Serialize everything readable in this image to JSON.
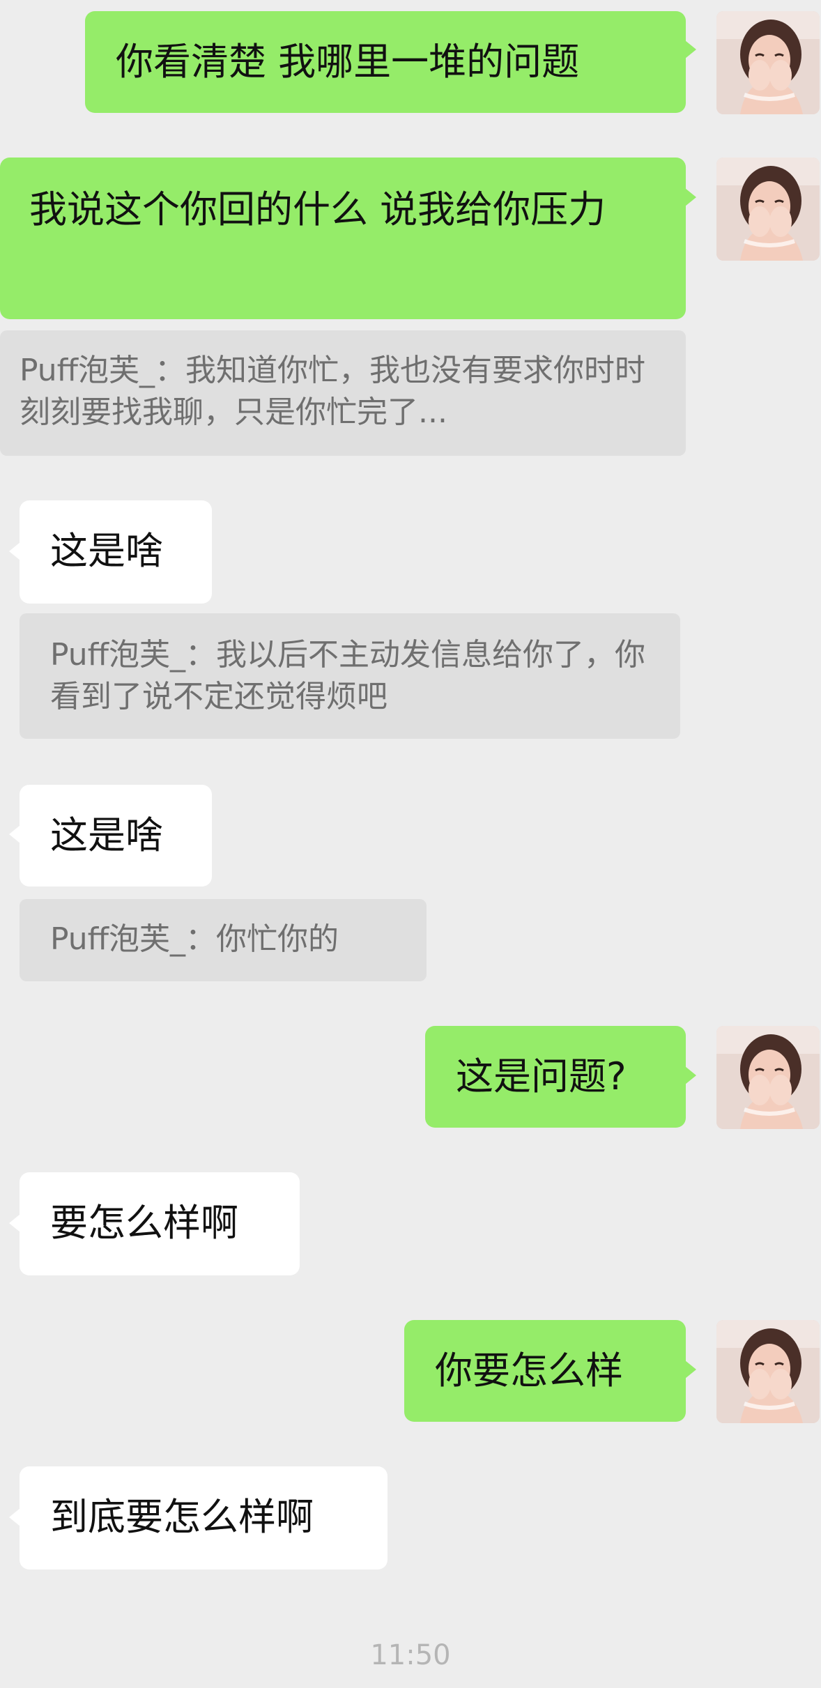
{
  "conversation": {
    "messages": [
      {
        "type": "sent",
        "text": "你看清楚 我哪里一堆的问题"
      },
      {
        "type": "sent",
        "text": "我说这个你回的什么 说我给你压力"
      },
      {
        "type": "quote",
        "text": "Puff泡芙_：我知道你忙，我也没有要求你时时刻刻要找我聊，只是你忙完了..."
      },
      {
        "type": "received",
        "text": "这是啥"
      },
      {
        "type": "quote",
        "text": "Puff泡芙_：我以后不主动发信息给你了，你看到了说不定还觉得烦吧"
      },
      {
        "type": "received",
        "text": "这是啥"
      },
      {
        "type": "quote",
        "text": "Puff泡芙_：你忙你的"
      },
      {
        "type": "sent",
        "text": "这是问题?"
      },
      {
        "type": "received",
        "text": "要怎么样啊"
      },
      {
        "type": "sent",
        "text": "你要怎么样"
      },
      {
        "type": "received",
        "text": "到底要怎么样啊"
      }
    ],
    "timestamp": "11:50"
  },
  "avatar": {
    "icon": "user-avatar-photo",
    "colors": {
      "background": "#e8d8d2",
      "hair": "#4a2f28",
      "skin": "#f3cdbd"
    }
  },
  "colors": {
    "chat_background": "#ededed",
    "sent_bubble": "#95ec69",
    "received_bubble": "#ffffff",
    "quote_background": "#dfdfdf",
    "quote_text": "#6f6f6f",
    "timestamp_text": "#b5b5b5"
  }
}
